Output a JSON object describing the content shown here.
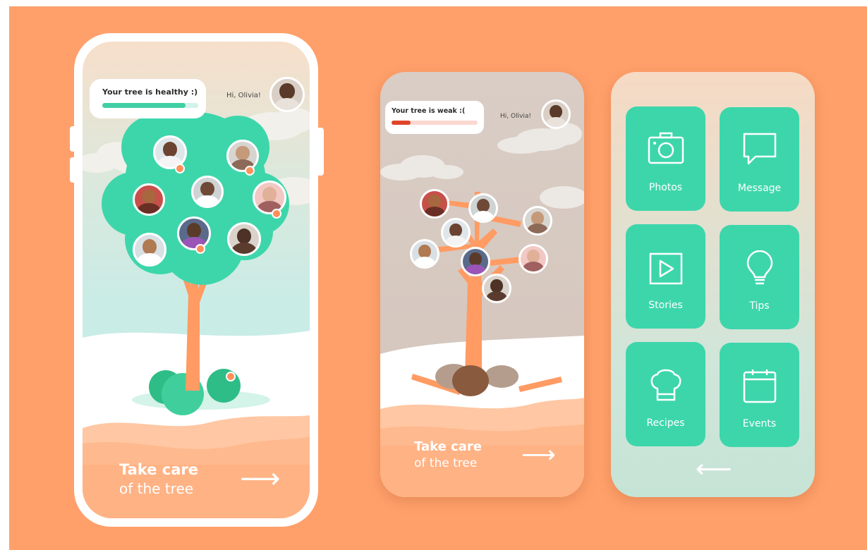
{
  "phone_healthy": {
    "status_title": "Your tree is healthy :)",
    "health_level": 0.87,
    "greeting": "Hi, Olivia!",
    "cta_title": "Take care",
    "cta_subtitle": "of the tree",
    "cta_arrow": "⟶"
  },
  "phone_weak": {
    "status_title": "Your tree is weak :(",
    "health_level": 0.22,
    "greeting": "Hi, Olivia!",
    "cta_title": "Take care",
    "cta_subtitle": "of the tree",
    "cta_arrow": "⟶"
  },
  "menu": {
    "tiles": [
      {
        "label": "Photos",
        "icon": "camera-icon"
      },
      {
        "label": "Message",
        "icon": "message-icon"
      },
      {
        "label": "Stories",
        "icon": "play-icon"
      },
      {
        "label": "Tips",
        "icon": "lightbulb-icon"
      },
      {
        "label": "Recipes",
        "icon": "chef-hat-icon"
      },
      {
        "label": "Events",
        "icon": "calendar-icon"
      }
    ],
    "back_arrow": "⟵"
  },
  "colors": {
    "background": "#ffa06b",
    "accent_green": "#3dd6ab",
    "healthy_bar": "#3fcfa4",
    "weak_bar": "#e0452a",
    "notification_dot": "#ff8f5a",
    "trunk": "#ff9b63"
  }
}
